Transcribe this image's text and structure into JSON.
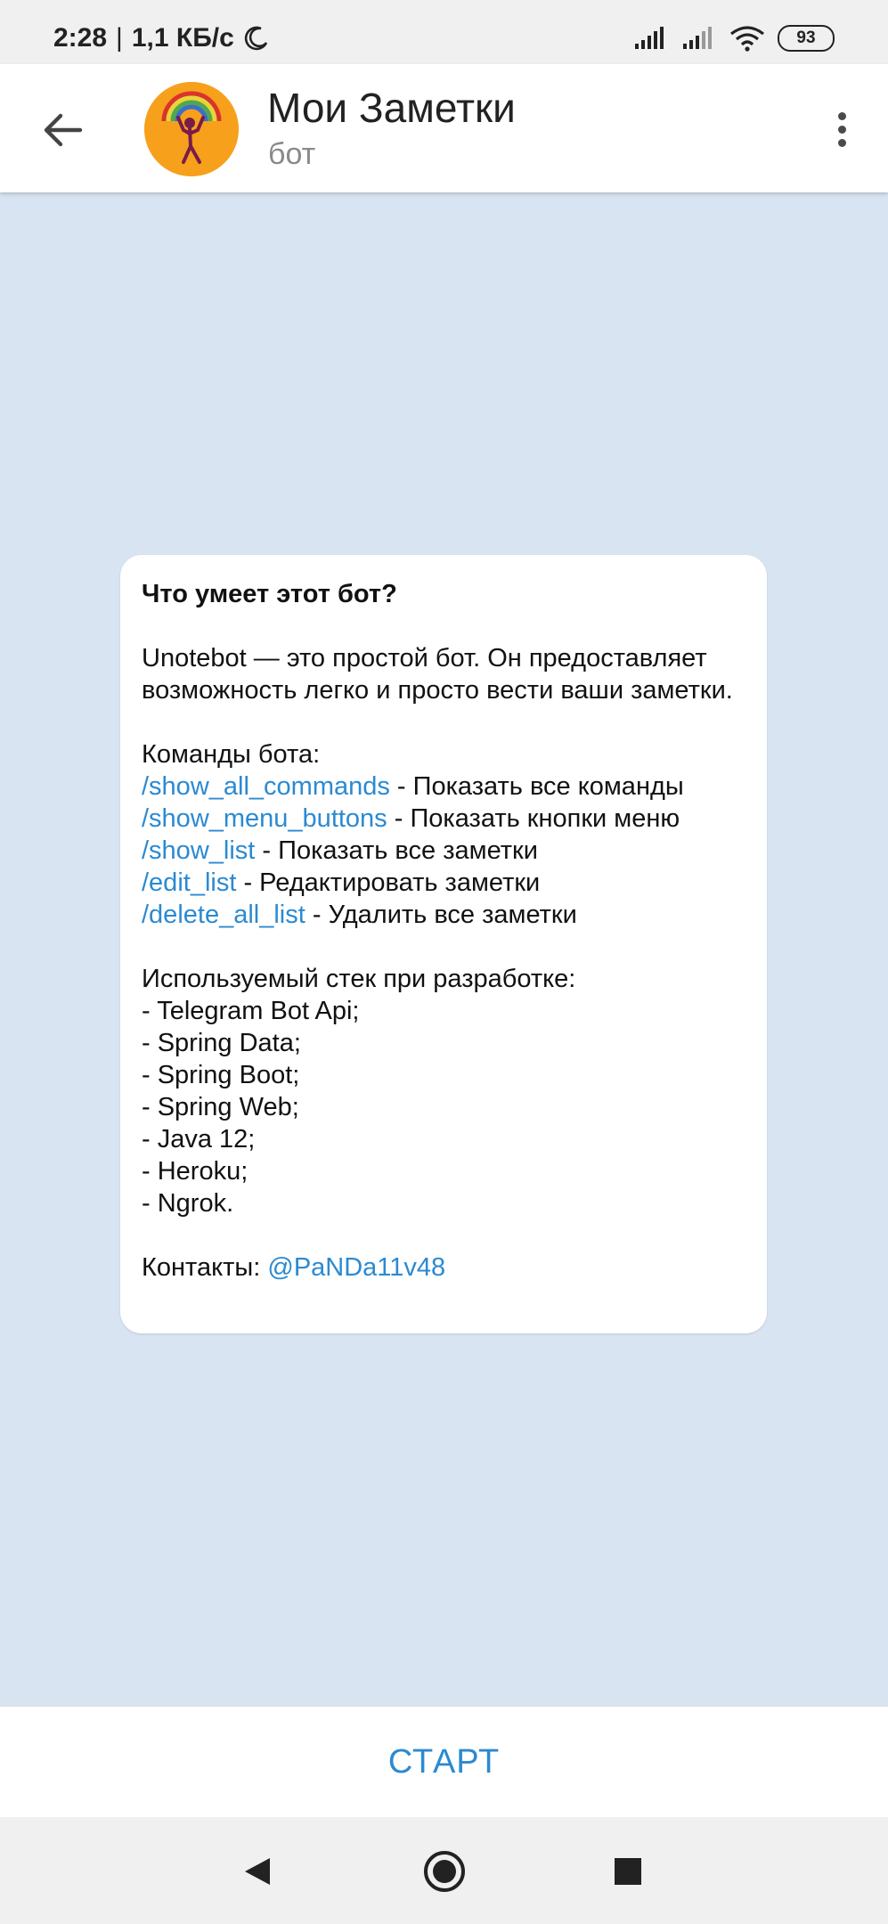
{
  "status_bar": {
    "time": "2:28",
    "separator": "|",
    "speed": "1,1 КБ/с",
    "battery": "93",
    "icons": [
      "moon-icon",
      "signal-icon",
      "signal-icon",
      "wifi-icon",
      "battery-icon"
    ]
  },
  "header": {
    "title": "Мои Заметки",
    "subtitle": "бот",
    "avatar_bg": "#f7a01c"
  },
  "card": {
    "heading": "Что умеет этот бот?",
    "description": "Unotebot — это простой бот. Он предоставляет возможность легко и просто вести ваши заметки.",
    "commands_title": "Команды бота:",
    "commands": [
      {
        "cmd": "/show_all_commands",
        "desc": " - Показать все команды"
      },
      {
        "cmd": "/show_menu_buttons",
        "desc": " - Показать кнопки меню"
      },
      {
        "cmd": "/show_list",
        "desc": " - Показать все заметки"
      },
      {
        "cmd": "/edit_list",
        "desc": " - Редактировать заметки"
      },
      {
        "cmd": "/delete_all_list",
        "desc": " - Удалить все заметки"
      }
    ],
    "stack_title": "Используемый стек при разработке:",
    "stack": [
      "- Telegram Bot Api;",
      "- Spring Data;",
      "- Spring Boot;",
      "- Spring Web;",
      "- Java 12;",
      "- Heroku;",
      "- Ngrok."
    ],
    "contacts_label": "Контакты: ",
    "contacts_link": "@PaNDa11v48"
  },
  "bottom": {
    "start_label": "СТАРТ"
  },
  "colors": {
    "accent": "#2b8ad1",
    "chat_bg": "#d9e4f2"
  }
}
